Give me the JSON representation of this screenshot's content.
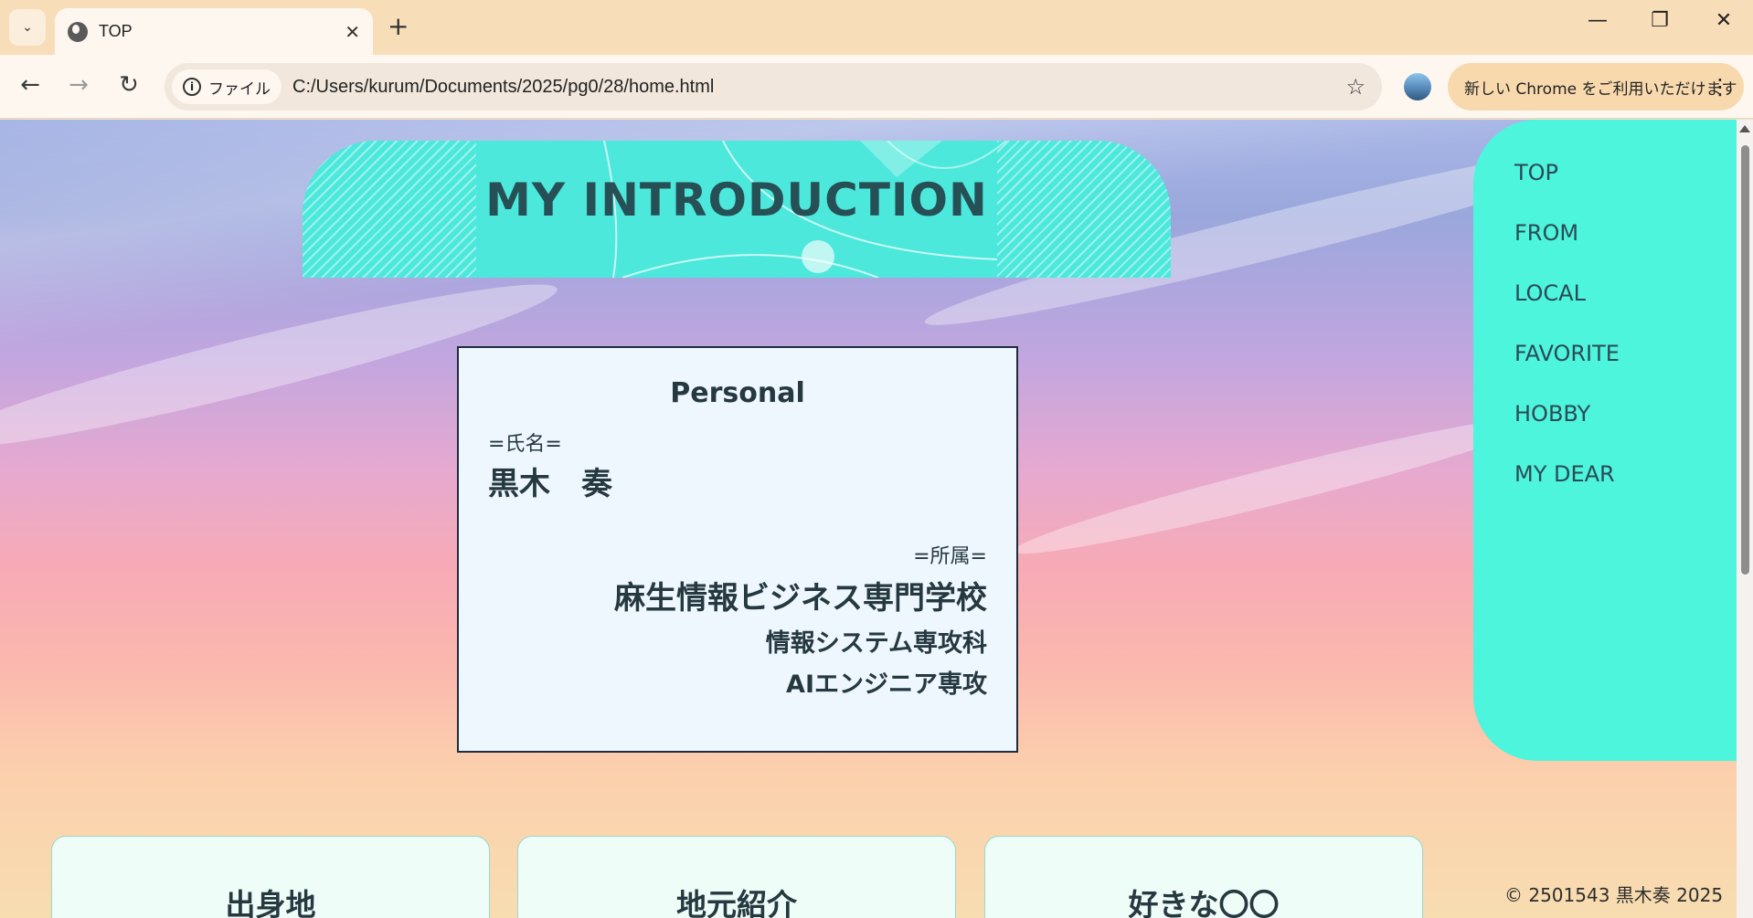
{
  "browser": {
    "tab_title": "TOP",
    "chip_label": "ファイル",
    "url": "C:/Users/kurum/Documents/2025/pg0/28/home.html",
    "update_label": "新しい Chrome をご利用いただけます"
  },
  "page": {
    "banner_title": "MY INTRODUCTION",
    "personal": {
      "heading": "Personal",
      "name_label": "=氏名=",
      "name": "黒木　奏",
      "affiliation_label": "=所属=",
      "school": "麻生情報ビジネス専門学校",
      "department": "情報システム専攻科",
      "major": "AIエンジニア専攻"
    },
    "nav": [
      "TOP",
      "FROM",
      "LOCAL",
      "FAVORITE",
      "HOBBY",
      "MY DEAR"
    ],
    "cards": [
      "出身地",
      "地元紹介",
      "好きな〇〇"
    ],
    "copyright": "© 2501543 黒木奏 2025"
  },
  "colors": {
    "accent": "#4df5dc",
    "banner": "#4de8dc",
    "text_dark": "#263840",
    "tabstrip": "#f8deb8"
  }
}
